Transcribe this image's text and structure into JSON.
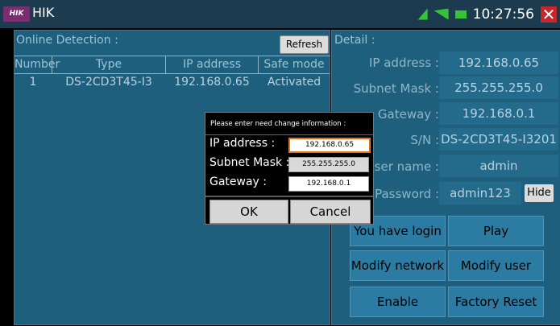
{
  "titlebar": {
    "logo": "HIK",
    "title": "HIK",
    "time": "10:27:56",
    "close": "✕"
  },
  "left": {
    "title": "Online Detection :",
    "refresh": "Refresh",
    "columns": [
      "Number",
      "Type",
      "IP address",
      "Safe mode"
    ],
    "rows": [
      [
        "1",
        "DS-2CD3T45-I3",
        "192.168.0.65",
        "Activated"
      ]
    ]
  },
  "detail": {
    "title": "Detail :",
    "fields": [
      {
        "label": "IP address :",
        "value": "192.168.0.65"
      },
      {
        "label": "Subnet Mask :",
        "value": "255.255.255.0"
      },
      {
        "label": "Gateway :",
        "value": "192.168.0.1"
      },
      {
        "label": "S/N :",
        "value": "DS-2CD3T45-I3201"
      },
      {
        "label": "User name :",
        "value": "admin"
      },
      {
        "label": "Password :",
        "value": "admin123"
      }
    ],
    "hide": "Hide",
    "buttons": [
      "You have login",
      "Play",
      "Modify network",
      "Modify user",
      "Enable",
      "Factory Reset"
    ]
  },
  "dialog": {
    "title": "Please enter need change information :",
    "ip_label": "IP address :",
    "ip_value": "192.168.0.65",
    "mask_label": "Subnet Mask :",
    "mask_value": "255.255.255.0",
    "gw_label": "Gateway :",
    "gw_value": "192.168.0.1",
    "ok": "OK",
    "cancel": "Cancel"
  }
}
